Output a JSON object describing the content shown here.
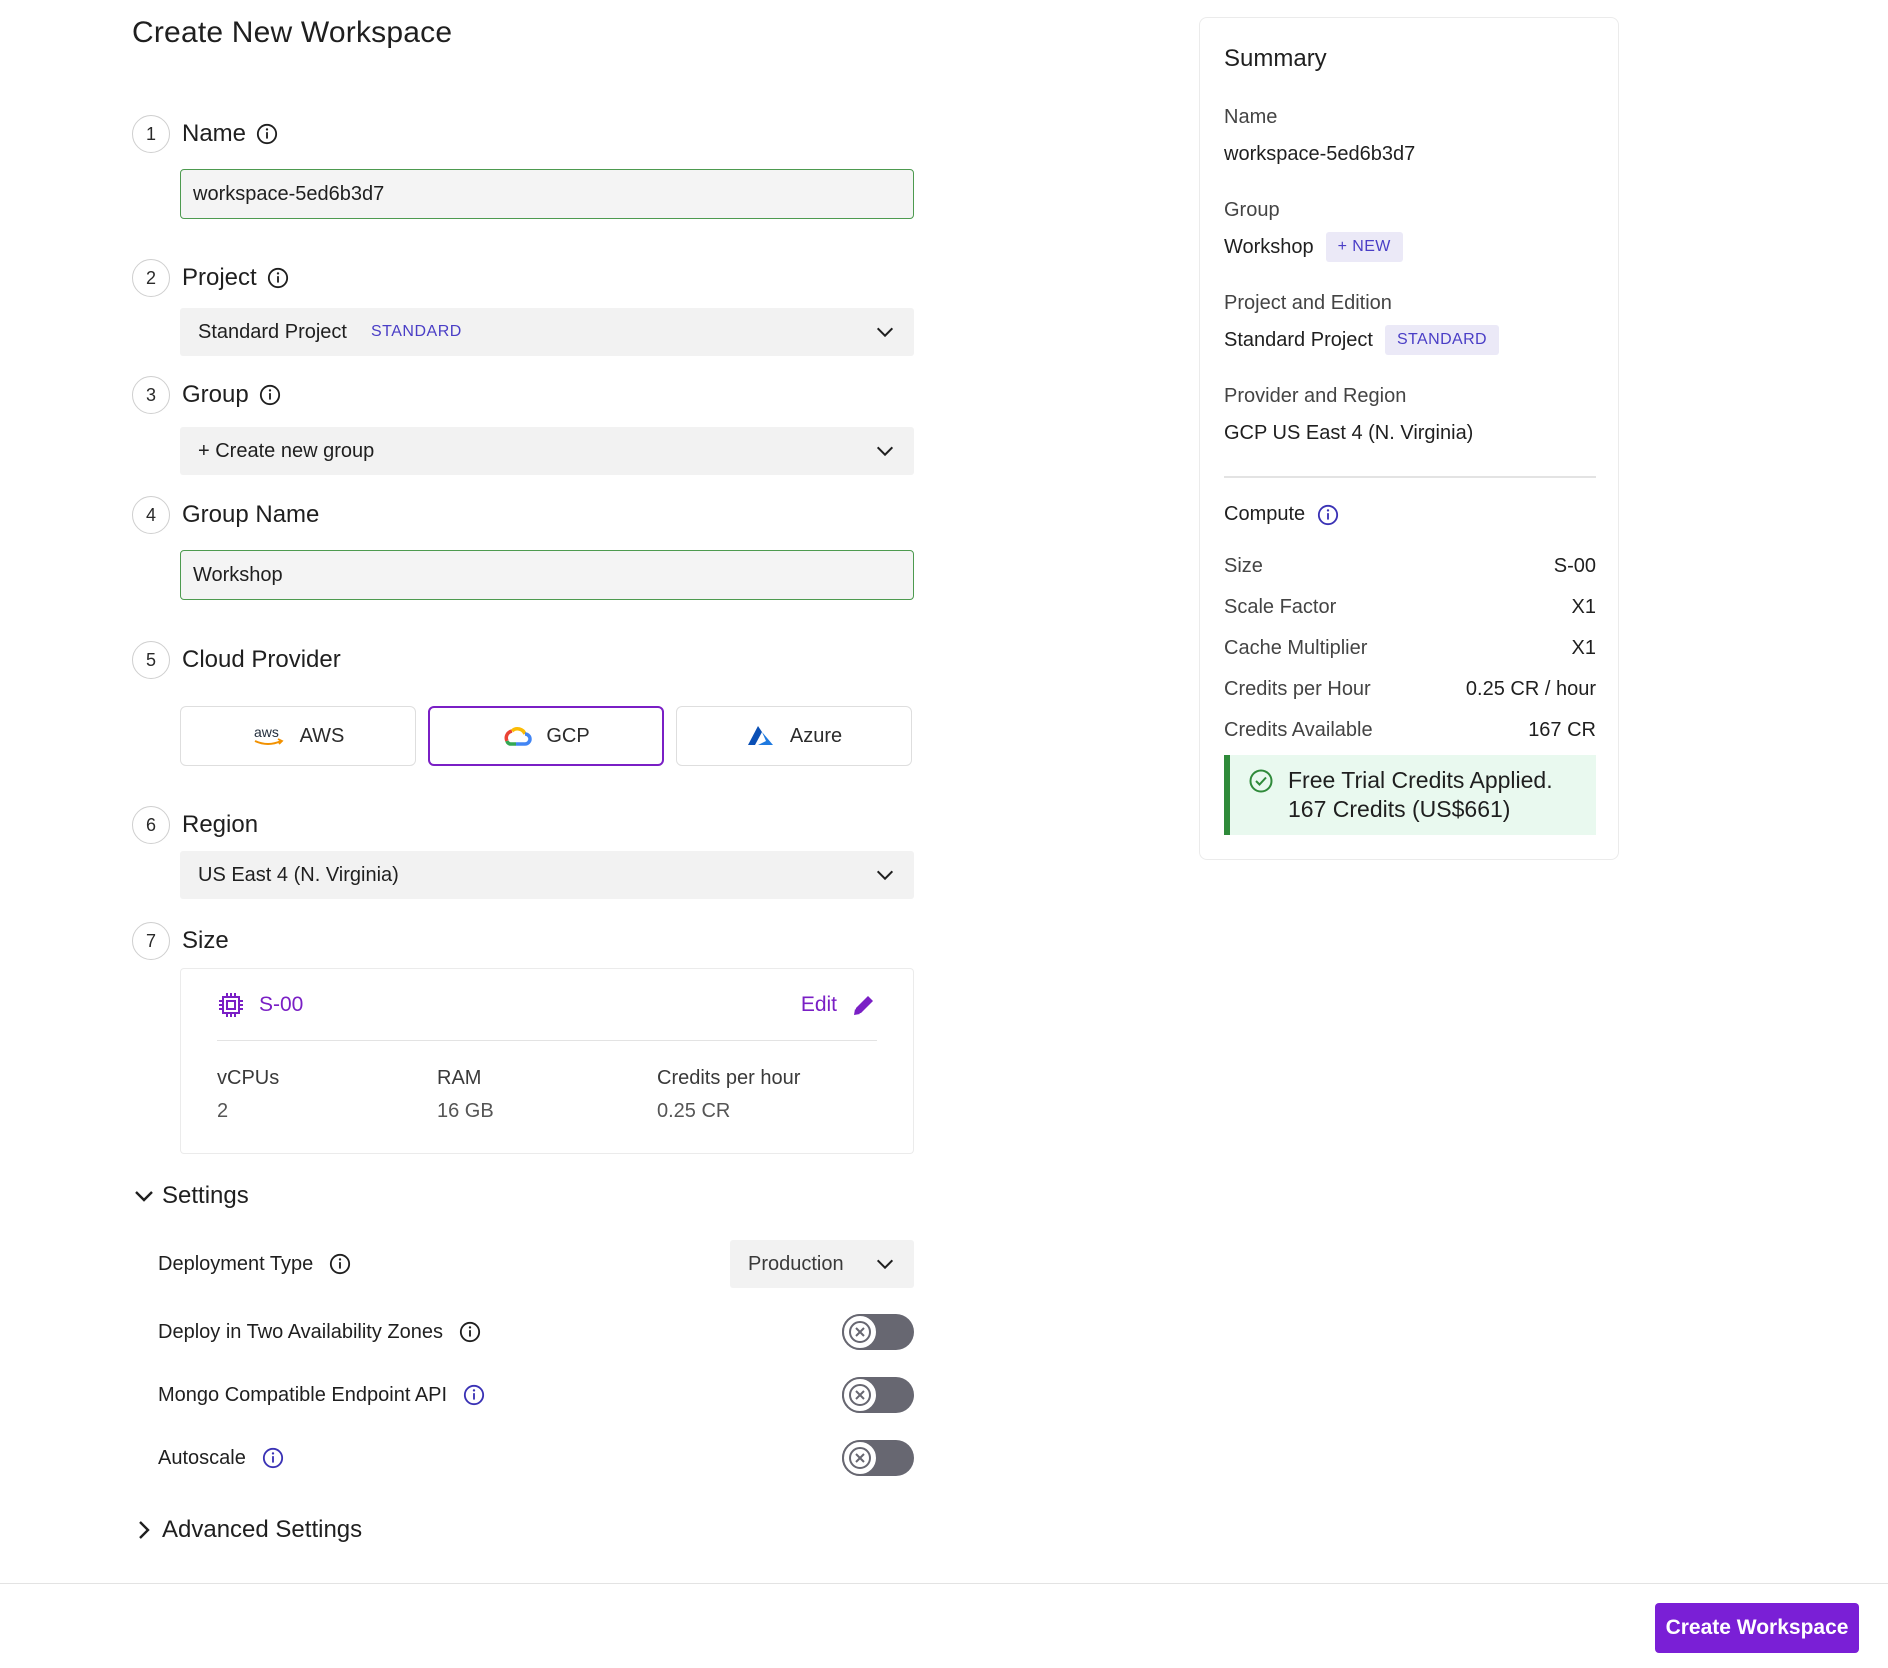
{
  "page_title": "Create New Workspace",
  "steps": {
    "name": {
      "num": "1",
      "label": "Name",
      "value": "workspace-5ed6b3d7"
    },
    "project": {
      "num": "2",
      "label": "Project",
      "value": "Standard Project",
      "badge": "STANDARD"
    },
    "group": {
      "num": "3",
      "label": "Group",
      "value": "+ Create new group"
    },
    "group_name": {
      "num": "4",
      "label": "Group Name",
      "value": "Workshop"
    },
    "cloud": {
      "num": "5",
      "label": "Cloud Provider",
      "providers": [
        "AWS",
        "GCP",
        "Azure"
      ],
      "selected": "GCP",
      "aws_logo_text": "aws"
    },
    "region": {
      "num": "6",
      "label": "Region",
      "value": "US East 4 (N. Virginia)"
    },
    "size": {
      "num": "7",
      "label": "Size",
      "name": "S-00",
      "edit": "Edit",
      "specs": [
        {
          "label": "vCPUs",
          "value": "2"
        },
        {
          "label": "RAM",
          "value": "16 GB"
        },
        {
          "label": "Credits per hour",
          "value": "0.25 CR"
        }
      ]
    }
  },
  "settings": {
    "title": "Settings",
    "deployment_type": {
      "label": "Deployment Type",
      "value": "Production"
    },
    "toggles": [
      {
        "label": "Deploy in Two Availability Zones",
        "on": false
      },
      {
        "label": "Mongo Compatible Endpoint API",
        "on": false
      },
      {
        "label": "Autoscale",
        "on": false
      }
    ]
  },
  "advanced": {
    "title": "Advanced Settings"
  },
  "create_button": "Create Workspace",
  "summary": {
    "title": "Summary",
    "name": {
      "label": "Name",
      "value": "workspace-5ed6b3d7"
    },
    "group": {
      "label": "Group",
      "value": "Workshop",
      "pill": "+ NEW"
    },
    "project": {
      "label": "Project and Edition",
      "value": "Standard Project",
      "pill": "STANDARD"
    },
    "provider": {
      "label": "Provider and Region",
      "value": "GCP US East 4 (N. Virginia)"
    },
    "compute": {
      "title": "Compute",
      "rows": [
        {
          "k": "Size",
          "v": "S-00"
        },
        {
          "k": "Scale Factor",
          "v": "X1"
        },
        {
          "k": "Cache Multiplier",
          "v": "X1"
        },
        {
          "k": "Credits per Hour",
          "v": "0.25 CR / hour"
        },
        {
          "k": "Credits Available",
          "v": "167 CR"
        }
      ]
    },
    "trial": {
      "title": "Free Trial Credits Applied.",
      "sub": "167 Credits (US$661)"
    }
  },
  "colors": {
    "accent": "#7a1fd6",
    "badge": "#4a3ec6",
    "success": "#2f8a3a",
    "input_border": "#4d9a4f"
  }
}
